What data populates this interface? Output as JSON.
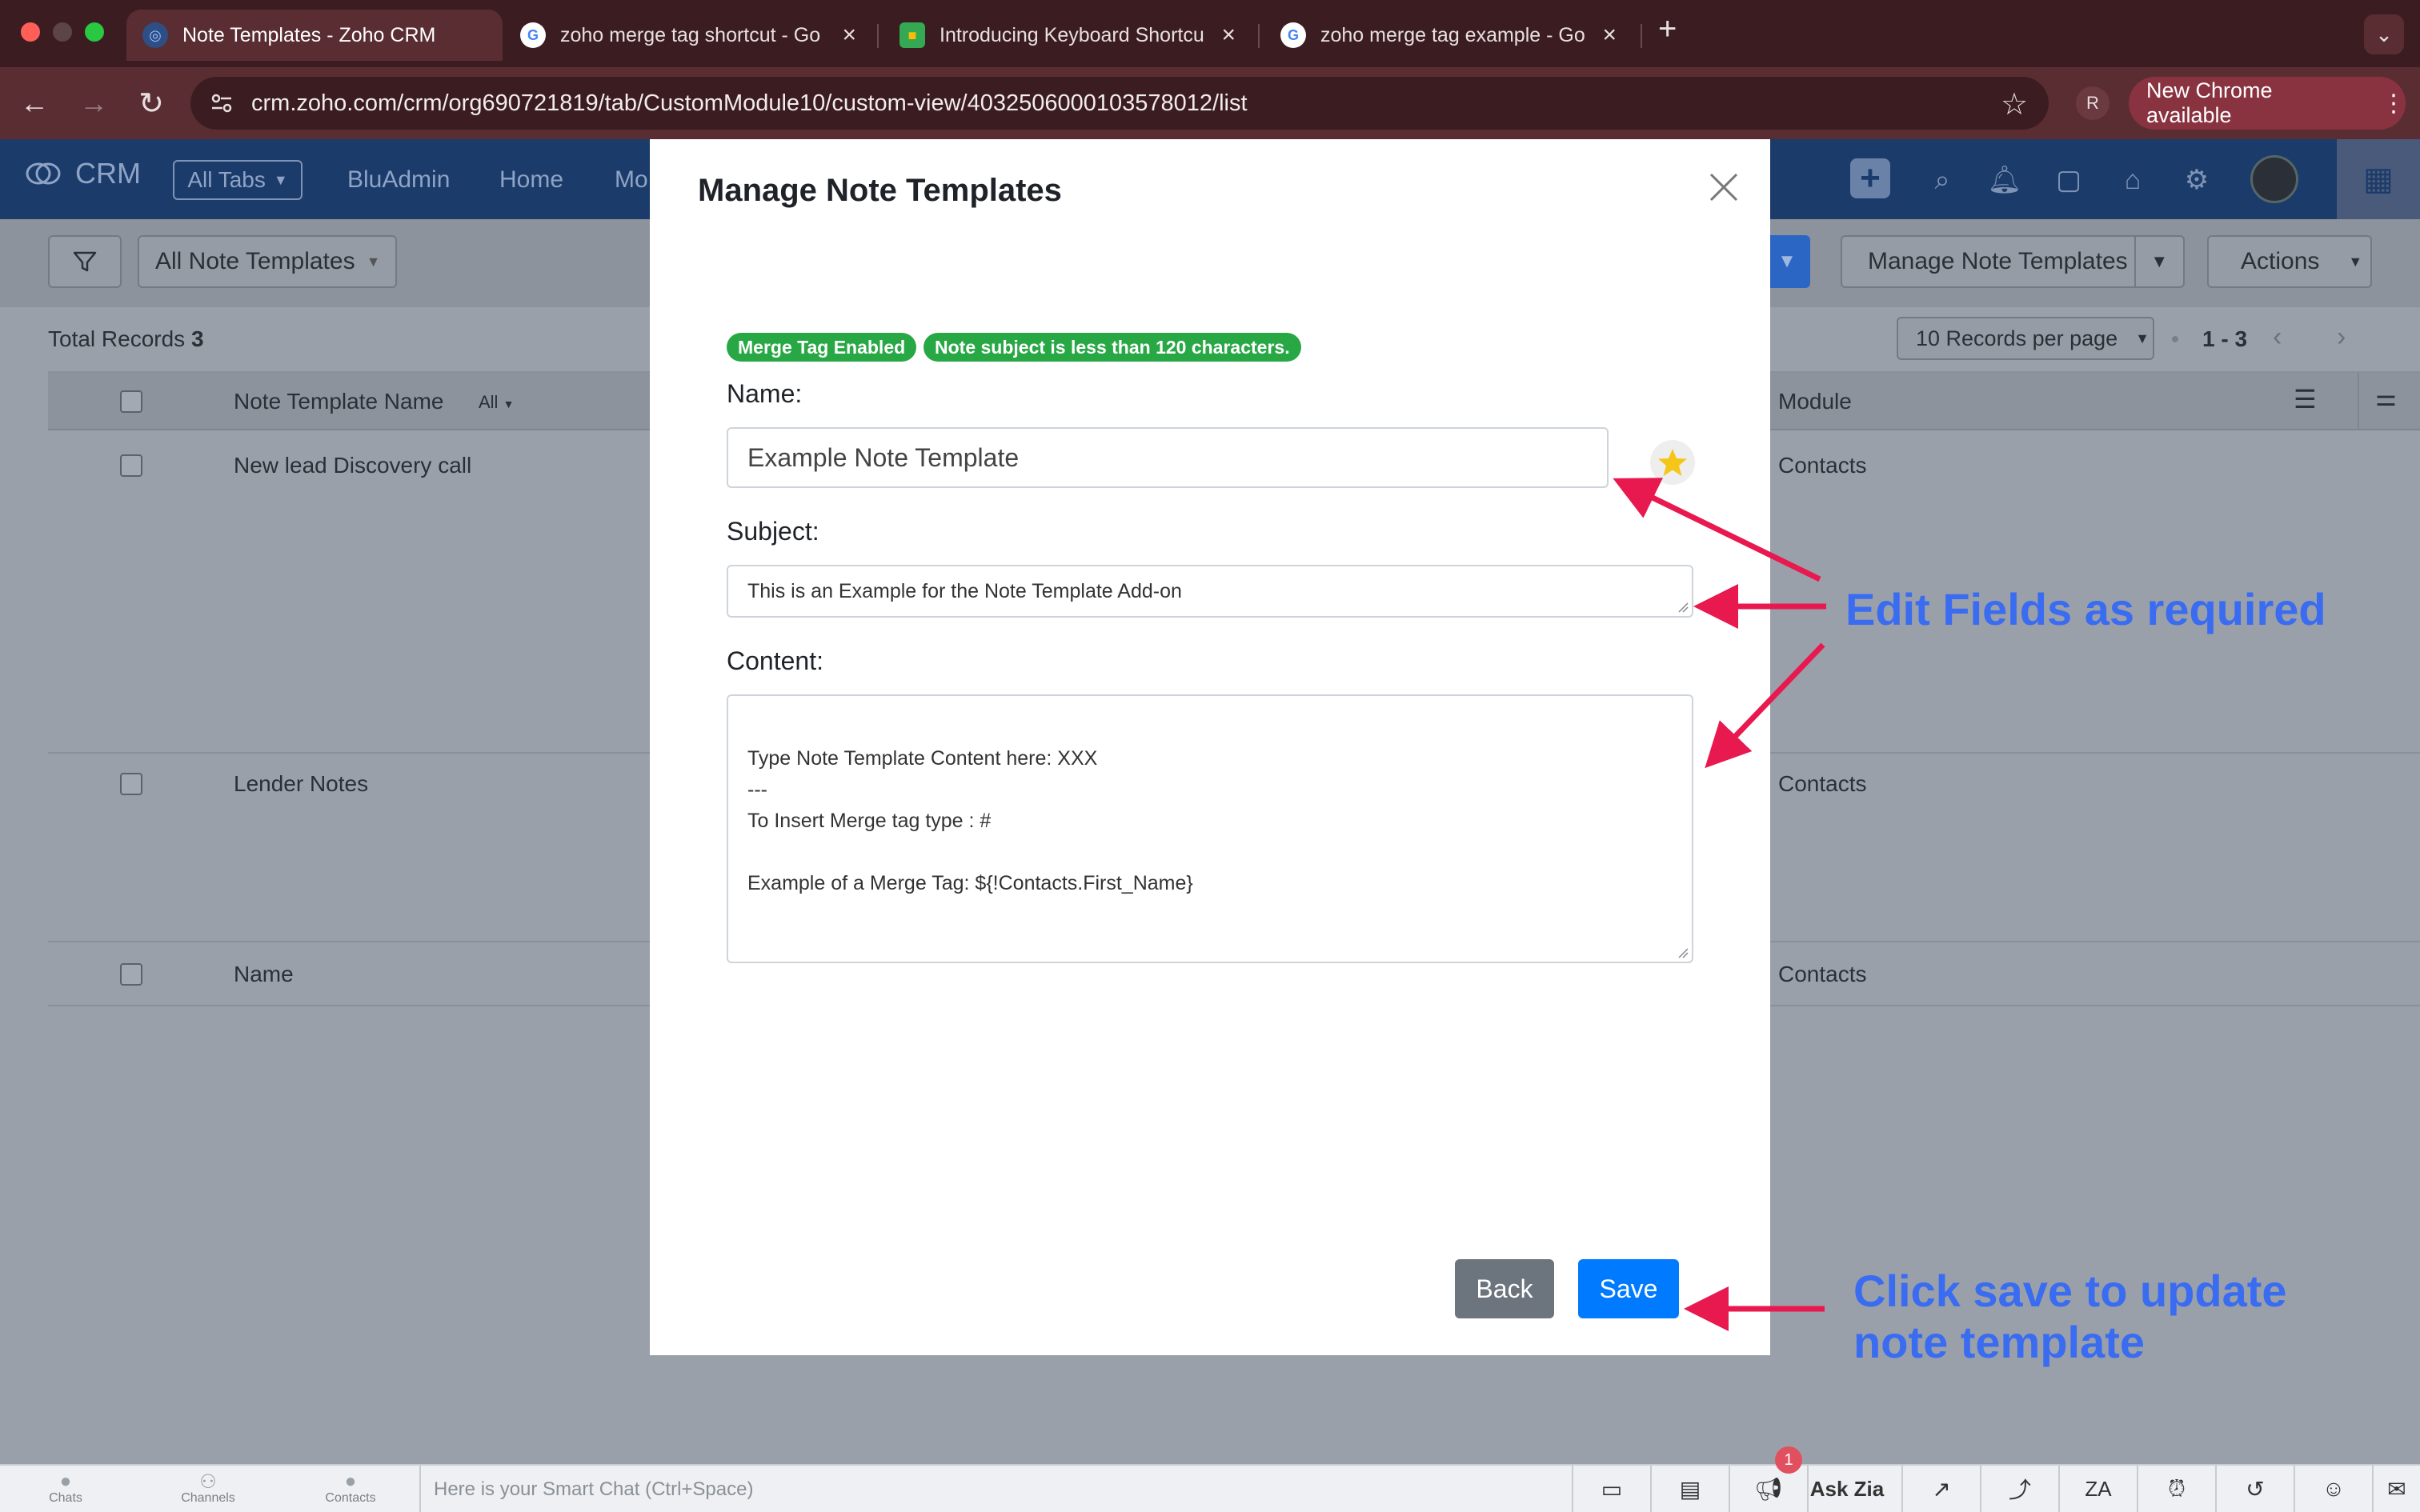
{
  "browser": {
    "tabs": [
      {
        "title": "Note Templates - Zoho CRM",
        "active": true
      },
      {
        "title": "zoho merge tag shortcut - Go",
        "active": false
      },
      {
        "title": "Introducing Keyboard Shortcu",
        "active": false
      },
      {
        "title": "zoho merge tag example - Go",
        "active": false
      }
    ],
    "new_tab_symbol": "+",
    "url": "crm.zoho.com/crm/org690721819/tab/CustomModule10/custom-view/4032506000103578012/list",
    "profile_initial": "R",
    "update_label": "New Chrome available"
  },
  "crm_header": {
    "logo_text": "CRM",
    "all_tabs_label": "All Tabs",
    "nav": [
      "BluAdmin",
      "Home",
      "Mo"
    ]
  },
  "list_toolbar": {
    "view_name": "All Note Templates",
    "manage_label": "Manage Note Templates",
    "actions_label": "Actions"
  },
  "records": {
    "total_label": "Total Records",
    "total_count": "3",
    "per_page": "10 Records per page",
    "range": "1 - 3"
  },
  "table": {
    "col_name": "Note Template Name",
    "col_filter": "All",
    "col_module": "Module",
    "rows": [
      {
        "name": "New lead Discovery call",
        "module": "Contacts"
      },
      {
        "name": "Lender Notes",
        "module": "Contacts"
      },
      {
        "name": "Name",
        "module": "Contacts"
      }
    ]
  },
  "modal": {
    "title": "Manage Note Templates",
    "badges": [
      "Merge Tag Enabled",
      "Note subject is less than 120 characters."
    ],
    "name_label": "Name:",
    "name_value": "Example Note Template",
    "subject_label": "Subject:",
    "subject_value": "This is an Example for the Note Template Add-on",
    "content_label": "Content:",
    "content_value": "Type Note Template Content here: XXX\n---\nTo Insert Merge tag type : #\n\nExample of a Merge Tag: ${!Contacts.First_Name}",
    "back_label": "Back",
    "save_label": "Save"
  },
  "annotations": {
    "edit_fields": "Edit Fields as required",
    "save_line1": "Click save to update",
    "save_line2": "note template"
  },
  "bottom_bar": {
    "items": [
      "Chats",
      "Channels",
      "Contacts"
    ],
    "smart_chat_placeholder": "Here is your Smart Chat (Ctrl+Space)",
    "ask_zia": "Ask Zia",
    "notification_count": "1"
  },
  "colors": {
    "badge_green": "#28a745",
    "save_blue": "#007bff",
    "back_gray": "#6c757d",
    "annotation_blue": "#3a6cf2",
    "arrow_red": "#e8194f"
  }
}
